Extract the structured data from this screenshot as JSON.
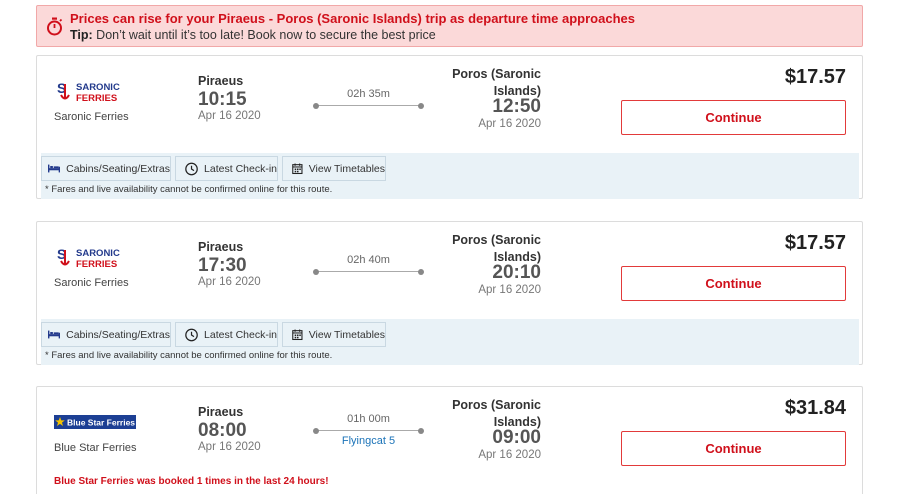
{
  "alert": {
    "title": "Prices can rise for your Piraeus - Poros (Saronic Islands) trip as departure time approaches",
    "tip_label": "Tip:",
    "tip_text": "Don’t wait until it’s too late! Book now to secure the best price",
    "icon": "stopwatch-icon",
    "color": "#d0101b"
  },
  "results": [
    {
      "operator_logo_icon": "saronic-ferries-logo",
      "operator": "Saronic Ferries",
      "dep_port": "Piraeus",
      "dep_time": "10:15",
      "dep_date": "Apr 16 2020",
      "duration": "02h 35m",
      "arr_port": "Poros (Saronic Islands)",
      "arr_time": "12:50",
      "arr_date": "Apr 16 2020",
      "price": "$17.57",
      "continue_label": "Continue",
      "chips": [
        {
          "label": "Cabins/Seating/Extras",
          "icon": "bed-icon"
        },
        {
          "label": "Latest Check-in",
          "icon": "clock-icon"
        },
        {
          "label": "View Timetables",
          "icon": "calendar-icon"
        }
      ],
      "note": "* Fares and live availability cannot be confirmed online for this route."
    },
    {
      "operator_logo_icon": "saronic-ferries-logo",
      "operator": "Saronic Ferries",
      "dep_port": "Piraeus",
      "dep_time": "17:30",
      "dep_date": "Apr 16 2020",
      "duration": "02h 40m",
      "arr_port": "Poros (Saronic Islands)",
      "arr_time": "20:10",
      "arr_date": "Apr 16 2020",
      "price": "$17.57",
      "continue_label": "Continue",
      "chips": [
        {
          "label": "Cabins/Seating/Extras",
          "icon": "bed-icon"
        },
        {
          "label": "Latest Check-in",
          "icon": "clock-icon"
        },
        {
          "label": "View Timetables",
          "icon": "calendar-icon"
        }
      ],
      "note": "* Fares and live availability cannot be confirmed online for this route."
    },
    {
      "operator_logo_icon": "blue-star-ferries-logo",
      "operator_logo_text": "Blue Star Ferries",
      "operator": "Blue Star Ferries",
      "dep_port": "Piraeus",
      "dep_time": "08:00",
      "dep_date": "Apr 16 2020",
      "duration": "01h 00m",
      "vessel": "Flyingcat 5",
      "arr_port": "Poros (Saronic Islands)",
      "arr_time": "09:00",
      "arr_date": "Apr 16 2020",
      "price": "$31.84",
      "continue_label": "Continue",
      "booked_notice": "Blue Star Ferries was booked 1 times in the last 24 hours!"
    }
  ],
  "saronic_logo": {
    "line1": "SARONIC",
    "line2": "FERRIES"
  },
  "colors": {
    "accent": "#d0101b",
    "info_bg": "#e9f2f7",
    "link": "#1b73b8",
    "navy": "#233a8c"
  }
}
